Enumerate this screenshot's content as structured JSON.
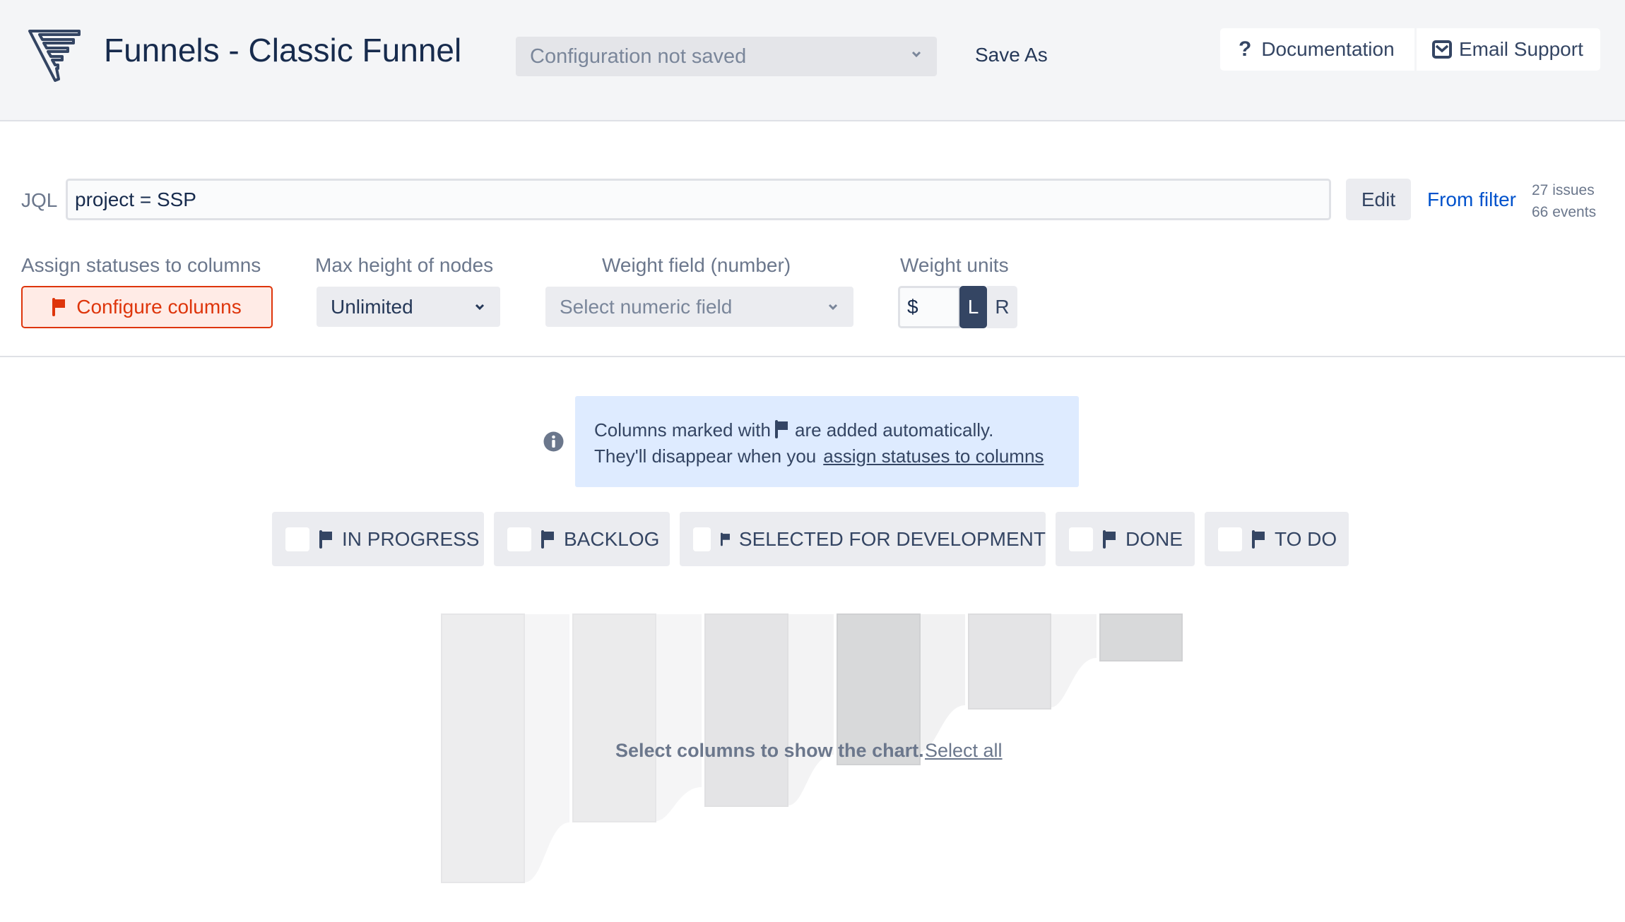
{
  "header": {
    "title": "Funnels - Classic Funnel",
    "config_select": "Configuration not saved",
    "save_as": "Save As",
    "documentation": "Documentation",
    "email_support": "Email Support"
  },
  "jql": {
    "label": "JQL",
    "value": "project = SSP",
    "edit": "Edit",
    "from_filter": "From filter",
    "issues": "27 issues",
    "events": "66 events"
  },
  "settings": {
    "assign_label": "Assign statuses to columns",
    "configure_button": "Configure columns",
    "max_height_label": "Max height of nodes",
    "max_height_value": "Unlimited",
    "weight_field_label": "Weight field (number)",
    "weight_field_placeholder": "Select numeric field",
    "weight_units_label": "Weight units",
    "weight_units_value": "$",
    "unit_left": "L",
    "unit_right": "R",
    "unit_selected": "L"
  },
  "info": {
    "line1_before": "Columns marked with",
    "line1_after": "are added automatically.",
    "line2": "They'll disappear when you",
    "link": "assign statuses to columns"
  },
  "columns": [
    {
      "label": "IN PROGRESS",
      "checked": false,
      "auto": true
    },
    {
      "label": "BACKLOG",
      "checked": false,
      "auto": true
    },
    {
      "label": "SELECTED FOR DEVELOPMENT",
      "checked": false,
      "auto": true
    },
    {
      "label": "DONE",
      "checked": false,
      "auto": true
    },
    {
      "label": "TO DO",
      "checked": false,
      "auto": true
    }
  ],
  "chart_placeholder": {
    "message": "Select columns to show the chart.",
    "select_all": "Select all"
  },
  "colors": {
    "header_bg": "#f4f5f7",
    "primary_text": "#172b4d",
    "link": "#0052cc",
    "danger": "#de350b",
    "info_bg": "#deebff",
    "selected_unit": "#344563"
  }
}
